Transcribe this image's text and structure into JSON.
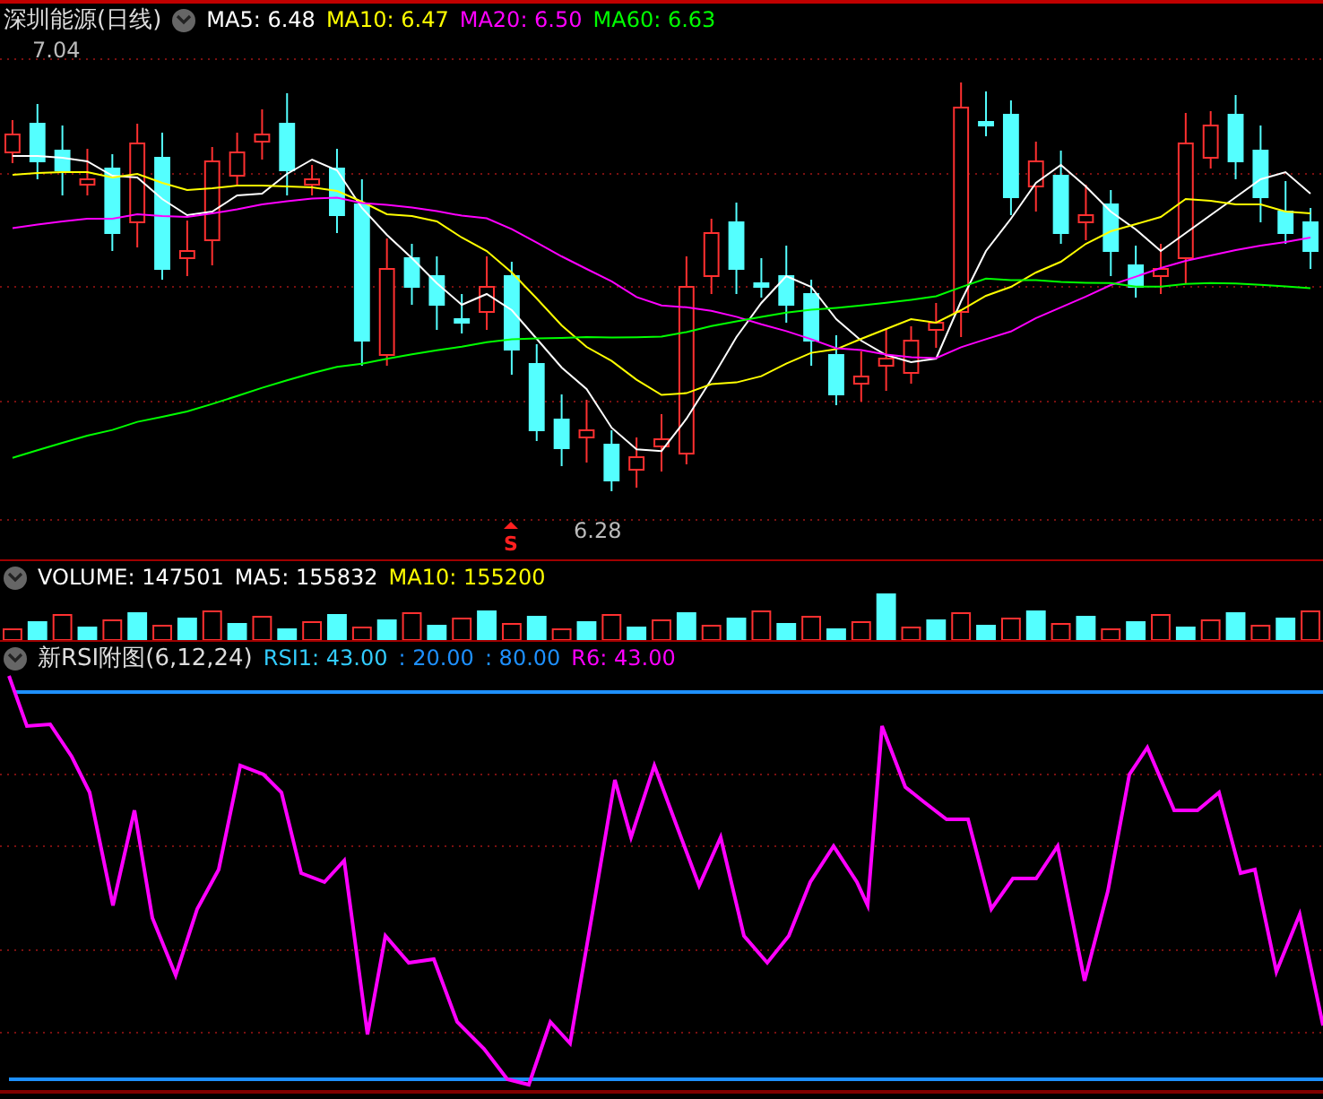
{
  "main_panel": {
    "title": "深圳能源(日线)",
    "indicators": [
      {
        "text": "MA5: 6.48",
        "color": "#ffffff"
      },
      {
        "text": "MA10: 6.47",
        "color": "#ffff00"
      },
      {
        "text": "MA20: 6.50",
        "color": "#ff00ff"
      },
      {
        "text": "MA60: 6.63",
        "color": "#00ff00"
      }
    ],
    "high_label": "7.04",
    "low_label": "6.28",
    "signal_mark": "S"
  },
  "volume_panel": {
    "indicators": [
      {
        "text": "VOLUME: 147501",
        "color": "#ffffff"
      },
      {
        "text": "MA5: 155832",
        "color": "#ffffff"
      },
      {
        "text": "MA10: 155200",
        "color": "#ffff00"
      }
    ]
  },
  "rsi_panel": {
    "title": "新RSI附图(6,12,24)",
    "indicators": [
      {
        "text": "RSI1: 43.00",
        "color": "#33ccff"
      },
      {
        "text": ": 20.00",
        "color": "#1e90ff"
      },
      {
        "text": ": 80.00",
        "color": "#1e90ff"
      },
      {
        "text": "R6: 43.00",
        "color": "#ff00ff"
      }
    ]
  }
}
